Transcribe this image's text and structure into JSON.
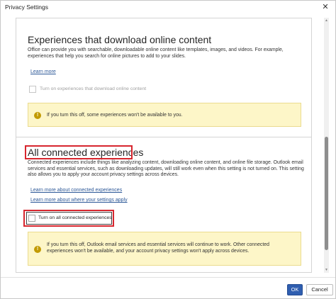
{
  "window": {
    "title": "Privacy Settings",
    "close_glyph": "✕"
  },
  "section1": {
    "heading": "Experiences that download online content",
    "description": "Office can provide you with searchable, downloadable online content like templates, images, and videos. For example, experiences that help you search for online pictures to add to your slides.",
    "learn_more": "Learn more",
    "checkbox_label": "Turn on experiences that download online content",
    "checkbox_checked": false,
    "checkbox_enabled": false,
    "info_text": "If you turn this off, some experiences won't be available to you."
  },
  "section2": {
    "heading": "All connected experiences",
    "description": "Connected experiences include things like analyzing content, downloading online content, and online file storage. Outlook email services and essential services, such as downloading updates, will still work even when this setting is not turned on. This setting also allows you to apply your account privacy settings across devices.",
    "link1": "Learn more about connected experiences",
    "link2": "Learn more about where your settings apply",
    "checkbox_label": "Turn on all connected experiences",
    "checkbox_checked": false,
    "info_text": "If you turn this off, Outlook email services and essential services will continue to work. Other connected experiences won't be available, and your account privacy settings won't apply across devices."
  },
  "footer": {
    "ok_label": "OK",
    "cancel_label": "Cancel"
  },
  "colors": {
    "accent": "#2f5eb0",
    "highlight": "#d7262e",
    "info_background": "#fdf6c8",
    "info_icon": "#c29a00",
    "link": "#2b5797"
  },
  "icons": {
    "info": "info-icon",
    "close": "close-icon",
    "scroll_up": "chevron-up-icon",
    "scroll_down": "chevron-down-icon"
  }
}
